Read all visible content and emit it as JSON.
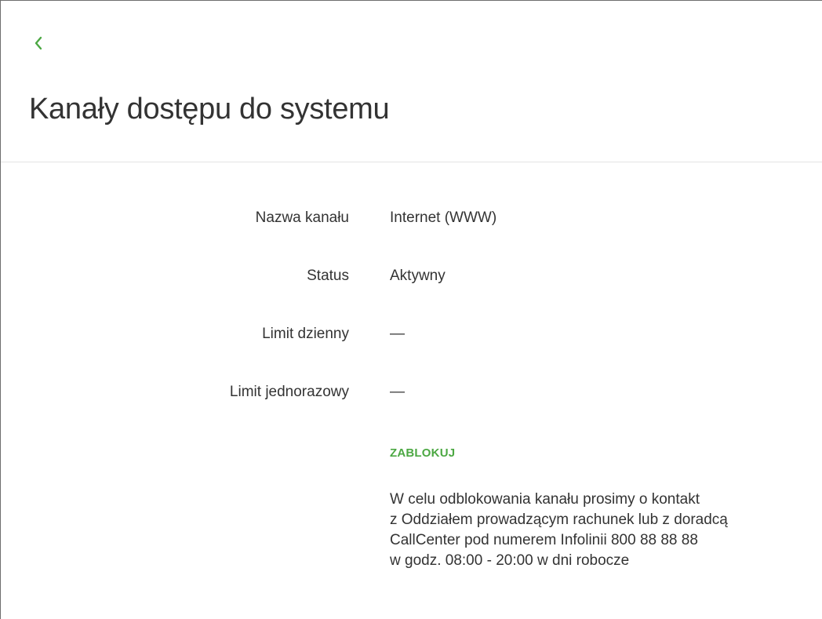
{
  "header": {
    "back_icon": "chevron-left-icon",
    "title": "Kanały dostępu do systemu"
  },
  "details": {
    "rows": [
      {
        "label": "Nazwa kanału",
        "value": "Internet (WWW)"
      },
      {
        "label": "Status",
        "value": "Aktywny"
      },
      {
        "label": "Limit dzienny",
        "value": "—"
      },
      {
        "label": "Limit jednorazowy",
        "value": "—"
      }
    ]
  },
  "actions": {
    "block_label": "ZABLOKUJ"
  },
  "info": {
    "lines": [
      "W celu odblokowania kanału prosimy o kontakt",
      "z Oddziałem prowadzącym rachunek lub z doradcą",
      "CallCenter pod numerem Infolinii 800 88 88 88",
      "w godz. 08:00 - 20:00 w dni robocze"
    ]
  },
  "colors": {
    "accent": "#4ca843",
    "text": "#333333",
    "divider": "#e3e3e3"
  }
}
